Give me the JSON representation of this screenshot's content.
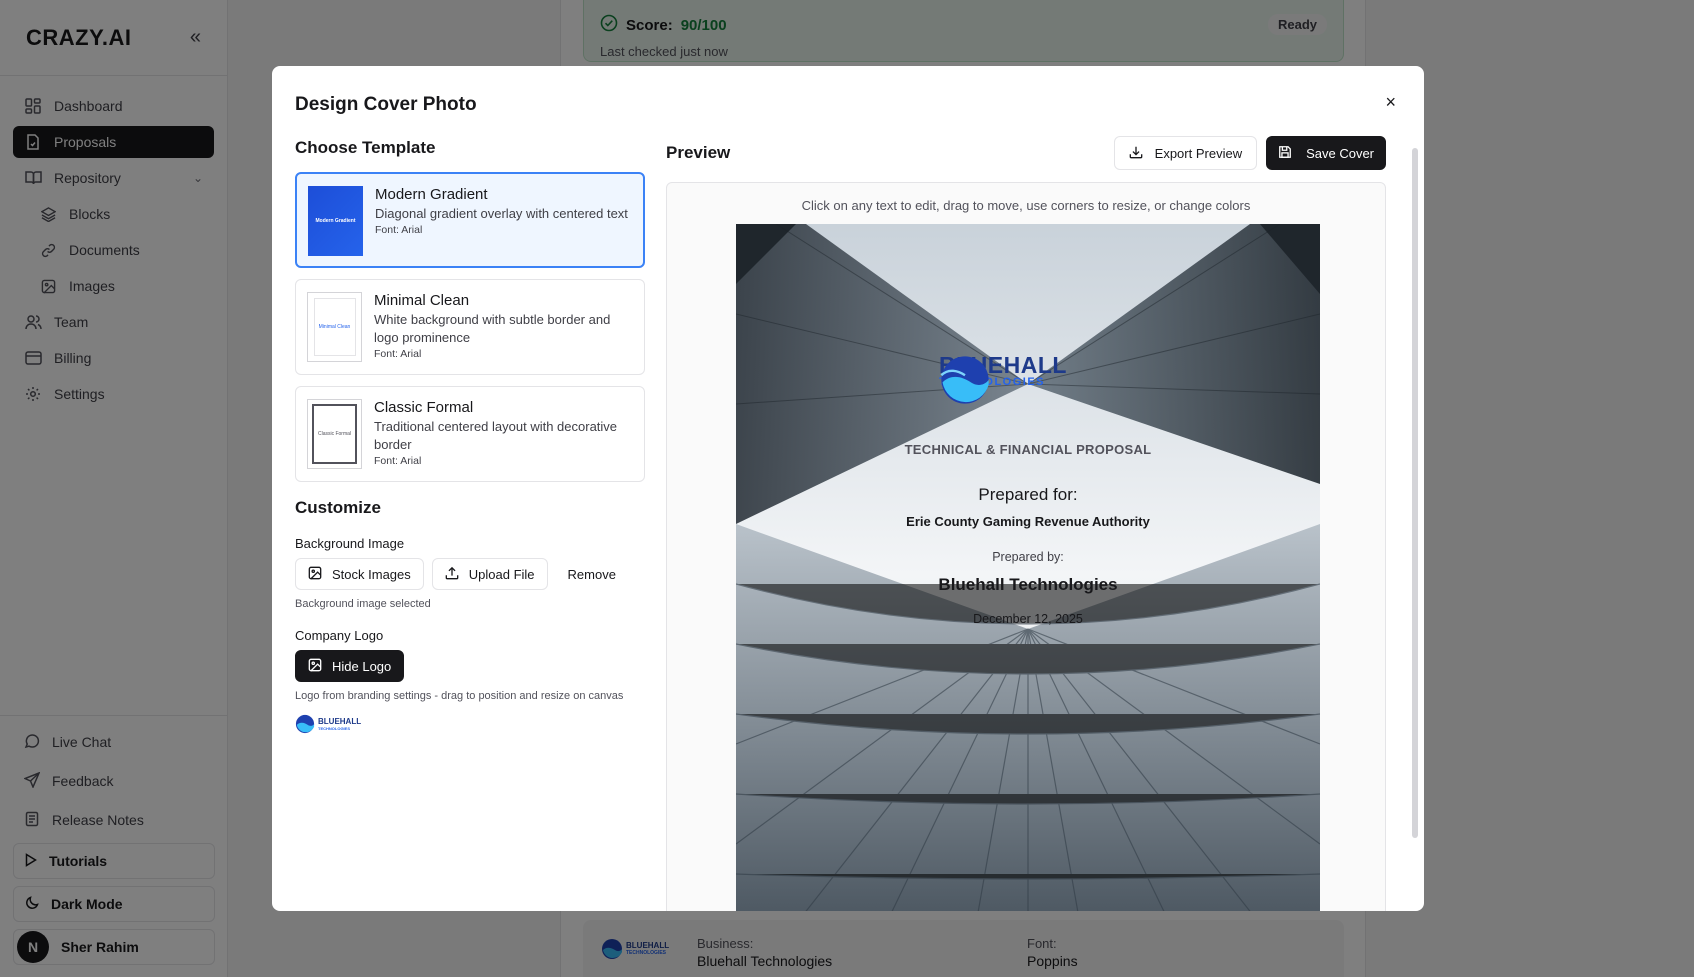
{
  "sidebar": {
    "logo": "CRAZY.AI",
    "collapse_icon": "«",
    "items": [
      {
        "label": "Dashboard"
      },
      {
        "label": "Proposals"
      },
      {
        "label": "Repository"
      },
      {
        "label": "Blocks"
      },
      {
        "label": "Documents"
      },
      {
        "label": "Images"
      },
      {
        "label": "Team"
      },
      {
        "label": "Billing"
      },
      {
        "label": "Settings"
      }
    ],
    "bottom": {
      "live_chat": "Live Chat",
      "feedback": "Feedback",
      "release_notes": "Release Notes",
      "tutorials": "Tutorials",
      "dark_mode": "Dark Mode",
      "user_initial": "N",
      "user_name": "Sher Rahim"
    }
  },
  "background": {
    "score_label": "Score:",
    "score_value": "90/100",
    "last_checked": "Last checked just now",
    "status": "Ready",
    "business_label": "Business:",
    "business_value": "Bluehall Technologies",
    "font_label": "Font:",
    "font_value": "Poppins",
    "logo_word1": "BLUEHALL",
    "logo_word2": "TECHNOLOGIES"
  },
  "modal": {
    "title": "Design Cover Photo",
    "close": "×",
    "choose_template": "Choose Template",
    "templates": [
      {
        "name": "Modern Gradient",
        "desc": "Diagonal gradient overlay with centered text",
        "font": "Font: Arial",
        "thumb": "Modern Gradient"
      },
      {
        "name": "Minimal Clean",
        "desc": "White background with subtle border and logo prominence",
        "font": "Font: Arial",
        "thumb": "Minimal Clean"
      },
      {
        "name": "Classic Formal",
        "desc": "Traditional centered layout with decorative border",
        "font": "Font: Arial",
        "thumb": "Classic Formal"
      }
    ],
    "customize": "Customize",
    "background_image_label": "Background Image",
    "stock_images": "Stock Images",
    "upload_file": "Upload File",
    "remove": "Remove",
    "bg_status": "Background image selected",
    "company_logo_label": "Company Logo",
    "hide_logo": "Hide Logo",
    "logo_hint": "Logo from branding settings - drag to position and resize on canvas",
    "mini_logo_word1": "BLUEHALL",
    "mini_logo_word2": "TECHNOLOGIES",
    "preview": "Preview",
    "export_preview": "Export Preview",
    "save_cover": "Save Cover",
    "canvas_hint": "Click on any text to edit, drag to move, use corners to resize, or change colors",
    "cover": {
      "logo_word1": "BLUEHALL",
      "logo_word2": "TECHNOLOGIES",
      "proposal_type": "TECHNICAL & FINANCIAL PROPOSAL",
      "prepared_for_label": "Prepared for:",
      "client": "Erie County Gaming Revenue Authority",
      "prepared_by_label": "Prepared by:",
      "company": "Bluehall Technologies",
      "date": "December 12, 2025"
    }
  },
  "colors": {
    "accent_dark": "#18181b",
    "selection_blue": "#3b82f6",
    "score_green": "#15803d",
    "brand_navy": "#1e3a8a"
  }
}
